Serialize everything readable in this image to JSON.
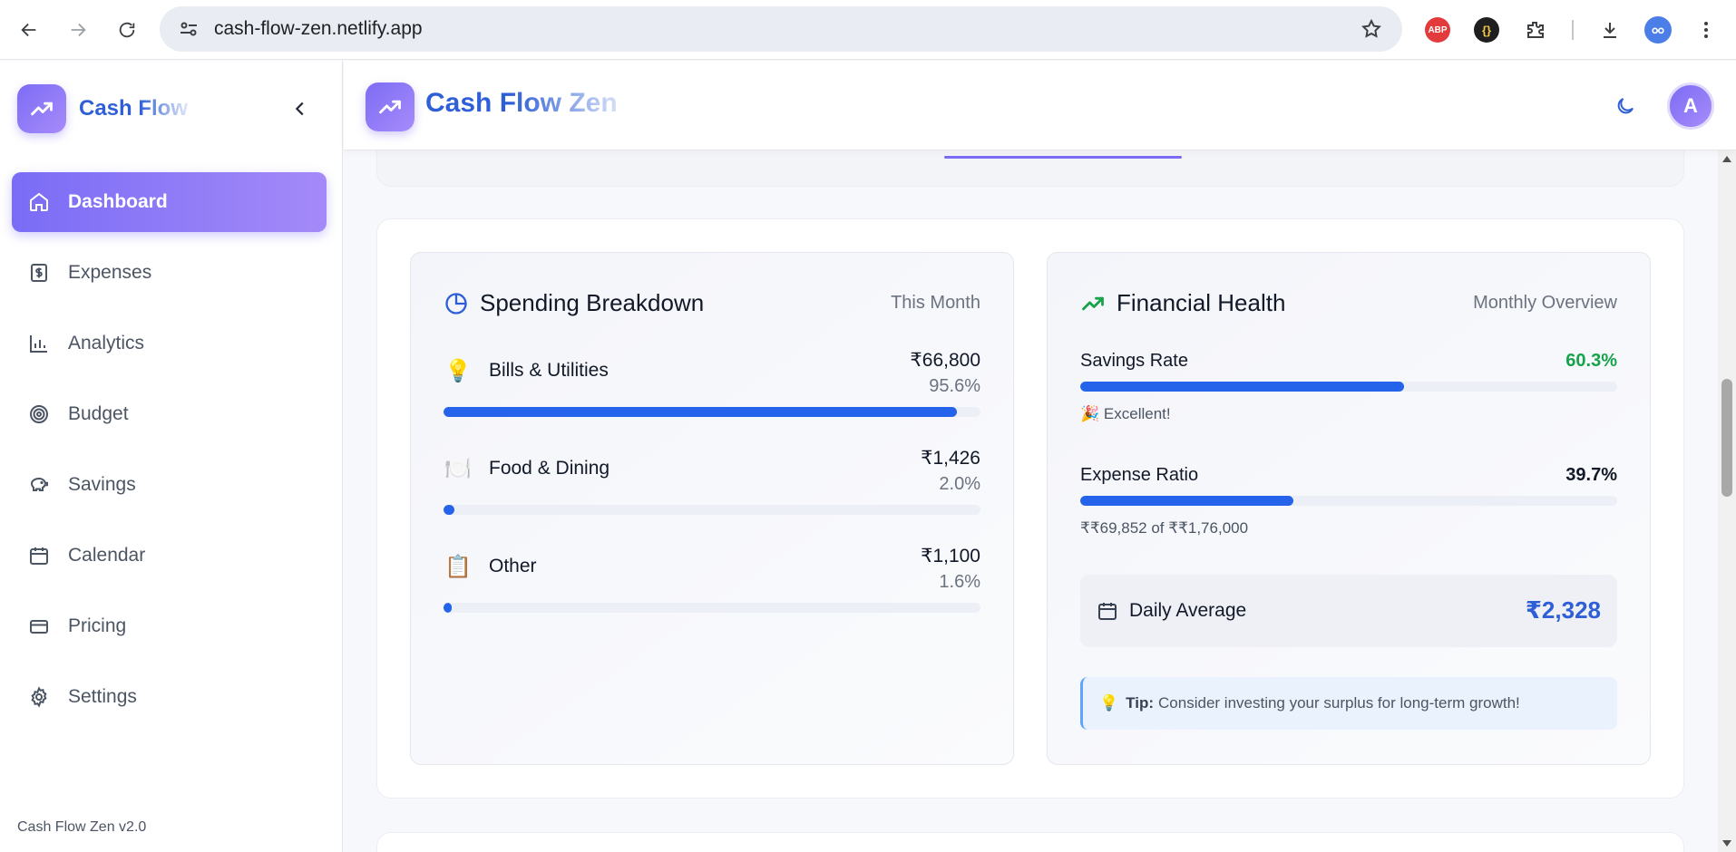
{
  "browser": {
    "url": "cash-flow-zen.netlify.app",
    "extensions": {
      "abp": "ABP",
      "json": "{}"
    }
  },
  "sidebar": {
    "brand": "Cash Flow",
    "items": [
      {
        "label": "Dashboard",
        "icon": "home-icon",
        "active": true
      },
      {
        "label": "Expenses",
        "icon": "receipt-icon"
      },
      {
        "label": "Analytics",
        "icon": "bar-chart-icon"
      },
      {
        "label": "Budget",
        "icon": "target-icon"
      },
      {
        "label": "Savings",
        "icon": "piggy-bank-icon"
      },
      {
        "label": "Calendar",
        "icon": "calendar-icon"
      },
      {
        "label": "Pricing",
        "icon": "credit-card-icon"
      },
      {
        "label": "Settings",
        "icon": "gear-icon"
      }
    ],
    "version": "Cash Flow Zen v2.0"
  },
  "header": {
    "title": "Cash Flow Zen",
    "avatar_initial": "A"
  },
  "spending": {
    "title": "Spending Breakdown",
    "period": "This Month",
    "categories": [
      {
        "emoji": "💡",
        "name": "Bills & Utilities",
        "amount": "₹66,800",
        "percent": "95.6%",
        "fill": 95.6
      },
      {
        "emoji": "🍽️",
        "name": "Food & Dining",
        "amount": "₹1,426",
        "percent": "2.0%",
        "fill": 2.0
      },
      {
        "emoji": "📋",
        "name": "Other",
        "amount": "₹1,100",
        "percent": "1.6%",
        "fill": 1.6
      }
    ]
  },
  "health": {
    "title": "Financial Health",
    "period": "Monthly Overview",
    "savings_rate": {
      "label": "Savings Rate",
      "value": "60.3%",
      "fill": 60.3,
      "note_emoji": "🎉",
      "note": "Excellent!"
    },
    "expense_ratio": {
      "label": "Expense Ratio",
      "value": "39.7%",
      "fill": 39.7,
      "note": "₹₹69,852 of ₹₹1,76,000"
    },
    "daily_average": {
      "label": "Daily Average",
      "value": "₹2,328"
    },
    "tip": {
      "emoji": "💡",
      "label": "Tip:",
      "text": "Consider investing your surplus for long-term growth!"
    }
  },
  "colors": {
    "accent": "#7a6cf6",
    "primary": "#2f5fd7",
    "bar": "#2563eb",
    "positive": "#16a34a"
  }
}
